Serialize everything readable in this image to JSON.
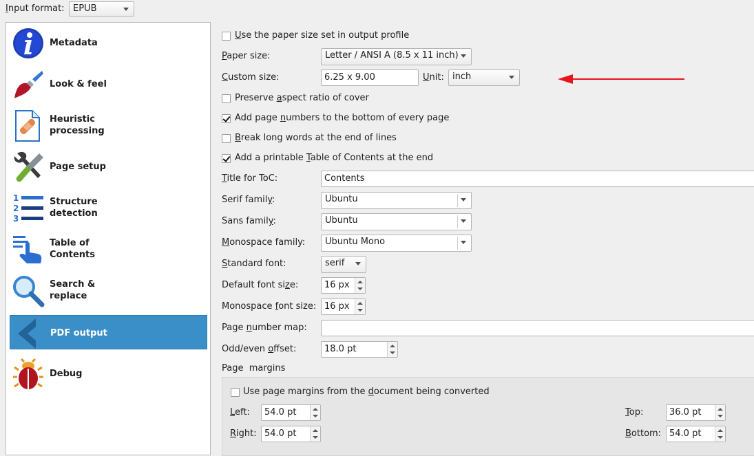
{
  "top": {
    "input_format_label": "Input format:",
    "input_format_value": "EPUB"
  },
  "sidebar": {
    "items": [
      {
        "label": "Metadata",
        "icon": "info-icon"
      },
      {
        "label": "Look & feel",
        "icon": "paintbrush-icon"
      },
      {
        "label": "Heuristic\nprocessing",
        "icon": "bandaid-document-icon"
      },
      {
        "label": "Page setup",
        "icon": "wrench-screwdriver-icon"
      },
      {
        "label": "Structure\ndetection",
        "icon": "numbered-list-icon"
      },
      {
        "label": "Table of\nContents",
        "icon": "toc-hand-icon"
      },
      {
        "label": "Search &\nreplace",
        "icon": "magnifier-icon"
      },
      {
        "label": "PDF output",
        "icon": "back-arrow-icon",
        "selected": true
      },
      {
        "label": "Debug",
        "icon": "bug-icon"
      }
    ],
    "selected_bg": "#3b8fc9"
  },
  "pdf": {
    "use_paper_size_label": "Use the paper size set in output profile",
    "use_paper_size_checked": false,
    "paper_size_label": "Paper size:",
    "paper_size_value": "Letter / ANSI A (8.5 x 11 inch)",
    "custom_size_label": "Custom size:",
    "custom_size_value": "6.25 x 9.00",
    "unit_label": "Unit:",
    "unit_value": "inch",
    "preserve_aspect_label": "Preserve aspect ratio of cover",
    "preserve_aspect_checked": false,
    "page_numbers_label": "Add page numbers to the bottom of every page",
    "page_numbers_checked": true,
    "break_words_label": "Break long words at the end of lines",
    "break_words_checked": false,
    "printable_toc_label": "Add a printable Table of Contents at the end",
    "printable_toc_checked": true,
    "toc_title_label": "Title for ToC:",
    "toc_title_value": "Contents",
    "serif_label": "Serif family:",
    "serif_value": "Ubuntu",
    "sans_label": "Sans family:",
    "sans_value": "Ubuntu",
    "mono_label": "Monospace family:",
    "mono_value": "Ubuntu Mono",
    "std_font_label": "Standard font:",
    "std_font_value": "serif",
    "default_size_label": "Default font size:",
    "default_size_value": "16 px",
    "mono_size_label": "Monospace font size:",
    "mono_size_value": "16 px",
    "page_map_label": "Page number map:",
    "page_map_value": "",
    "offset_label": "Odd/even offset:",
    "offset_value": "18.0 pt",
    "margins_title": "Page  margins",
    "margins_from_doc_label": "Use page margins from the document being converted",
    "margins_from_doc_checked": false,
    "left_label": "Left:",
    "left_value": "54.0 pt",
    "right_label": "Right:",
    "right_value": "54.0 pt",
    "top_label": "Top:",
    "top_value": "36.0 pt",
    "bottom_label": "Bottom:",
    "bottom_value": "54.0 pt"
  },
  "annotation": {
    "color": "#e8141b",
    "icon": "red-arrow-left"
  }
}
